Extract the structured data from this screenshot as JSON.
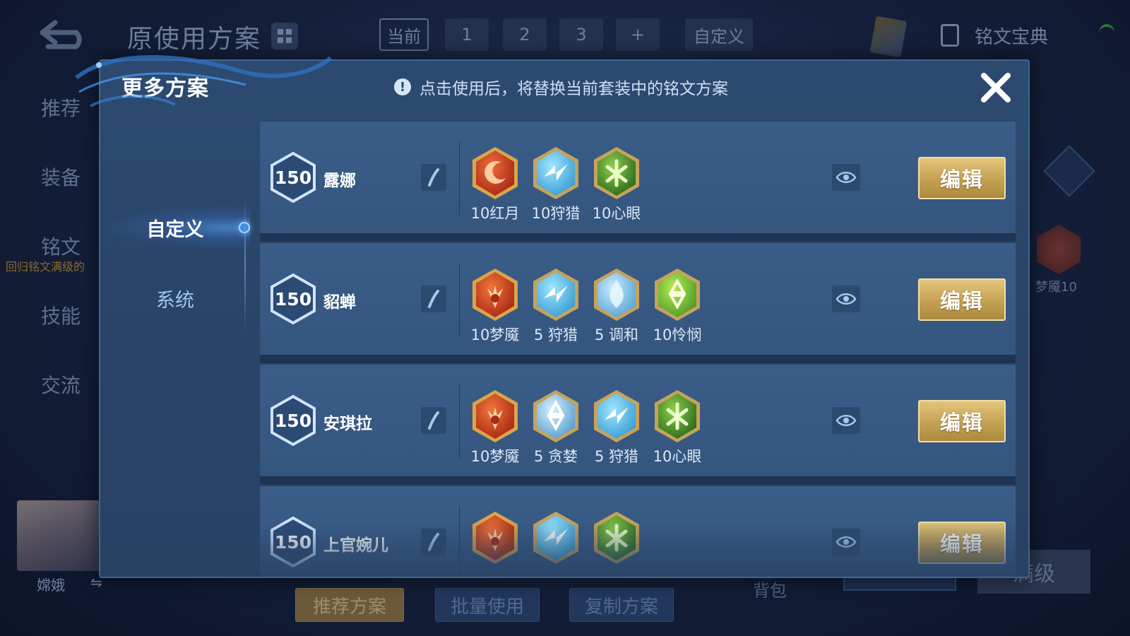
{
  "background": {
    "title": "原使用方案",
    "tabs": [
      "当前",
      "1",
      "2",
      "3",
      "+",
      "自定义"
    ],
    "book_label": "铭文宝典",
    "side_nav": [
      "推荐",
      "装备",
      "铭文",
      "技能",
      "交流"
    ],
    "side_sub": "回归铭文满级的",
    "hero_name": "嫦娥",
    "swap_icon": "⇋",
    "bottom_buttons": [
      "推荐方案",
      "批量使用",
      "复制方案"
    ],
    "bag_label": "背包",
    "max_label": "满级",
    "right_rune_label": "梦魇10"
  },
  "modal": {
    "title": "更多方案",
    "notice": "点击使用后，将替换当前套装中的铭文方案",
    "notice_icon": "!",
    "tabs": [
      {
        "label": "自定义",
        "active": true
      },
      {
        "label": "系统",
        "active": false
      }
    ],
    "edit_label": "编辑",
    "plans": [
      {
        "level": "150",
        "name": "露娜",
        "runes": [
          {
            "label": "10红月",
            "kind": "red-moon"
          },
          {
            "label": "10狩猎",
            "kind": "blue-lightning"
          },
          {
            "label": "10心眼",
            "kind": "green-heart"
          }
        ]
      },
      {
        "level": "150",
        "name": "貂蝉",
        "runes": [
          {
            "label": "10梦魇",
            "kind": "red-demon"
          },
          {
            "label": "5 狩猎",
            "kind": "blue-lightning"
          },
          {
            "label": "5 调和",
            "kind": "blue-drop"
          },
          {
            "label": "10怜悯",
            "kind": "green-star"
          }
        ]
      },
      {
        "level": "150",
        "name": "安琪拉",
        "runes": [
          {
            "label": "10梦魇",
            "kind": "red-demon"
          },
          {
            "label": "5 贪婪",
            "kind": "blue-star"
          },
          {
            "label": "5 狩猎",
            "kind": "blue-lightning"
          },
          {
            "label": "10心眼",
            "kind": "green-heart"
          }
        ]
      },
      {
        "level": "150",
        "name": "上官婉儿",
        "runes": [
          {
            "label": "",
            "kind": "red-demon"
          },
          {
            "label": "",
            "kind": "blue-lightning"
          },
          {
            "label": "",
            "kind": "green-heart"
          }
        ]
      }
    ]
  },
  "colors": {
    "accent_gold": "#c5a152",
    "panel": "#2a4569",
    "row": "#3a5d88",
    "rune_red": "#d8462a",
    "rune_blue": "#5fc2ea",
    "rune_green": "#4f9a3a"
  },
  "icons": [
    "back-arrow-icon",
    "grid-icon",
    "book-icon",
    "info-icon",
    "close-icon",
    "pen-icon",
    "eye-icon",
    "rune-icon",
    "level-badge-icon"
  ]
}
